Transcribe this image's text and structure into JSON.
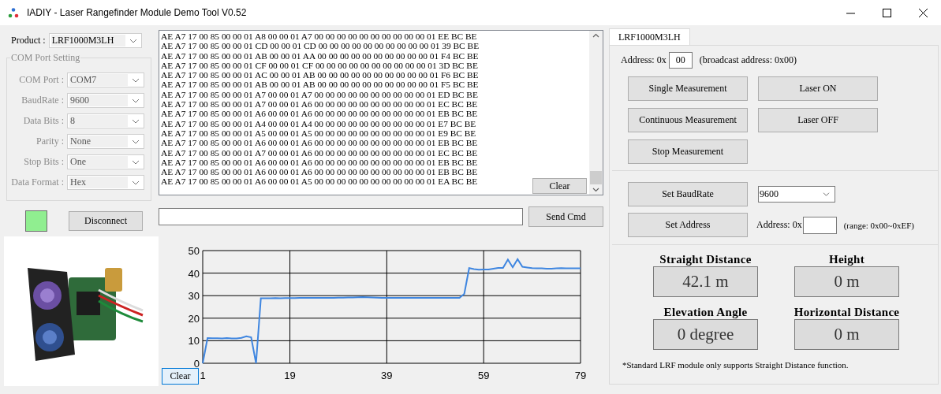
{
  "window": {
    "title": "IADIY - Laser Rangefinder Module Demo Tool V0.52"
  },
  "product": {
    "label": "Product :",
    "value": "LRF1000M3LH",
    "disabled": false
  },
  "com_port_setting": {
    "title": "COM Port Setting",
    "fields": [
      {
        "label": "COM Port :",
        "value": "COM7",
        "disabled": true
      },
      {
        "label": "BaudRate :",
        "value": "9600",
        "disabled": true
      },
      {
        "label": "Data Bits :",
        "value": "8",
        "disabled": true
      },
      {
        "label": "Parity :",
        "value": "None",
        "disabled": true
      },
      {
        "label": "Stop Bits :",
        "value": "One",
        "disabled": true
      },
      {
        "label": "Data Format :",
        "value": "Hex",
        "disabled": true
      }
    ]
  },
  "connection": {
    "connected": true,
    "button": "Disconnect"
  },
  "log": {
    "lines": [
      "AE A7 17 00 85 00 00 01 A8 00 00 01 A7 00 00 00 00 00 00 00 00 00 00 01 EE BC BE",
      "AE A7 17 00 85 00 00 01 CD 00 00 01 CD 00 00 00 00 00 00 00 00 00 00 01 39 BC BE",
      "AE A7 17 00 85 00 00 01 AB 00 00 01 AA 00 00 00 00 00 00 00 00 00 00 01 F4 BC BE",
      "AE A7 17 00 85 00 00 01 CF 00 00 01 CF 00 00 00 00 00 00 00 00 00 00 01 3D BC BE",
      "AE A7 17 00 85 00 00 01 AC 00 00 01 AB 00 00 00 00 00 00 00 00 00 00 01 F6 BC BE",
      "AE A7 17 00 85 00 00 01 AB 00 00 01 AB 00 00 00 00 00 00 00 00 00 00 01 F5 BC BE",
      "AE A7 17 00 85 00 00 01 A7 00 00 01 A7 00 00 00 00 00 00 00 00 00 00 01 ED BC BE",
      "AE A7 17 00 85 00 00 01 A7 00 00 01 A6 00 00 00 00 00 00 00 00 00 00 01 EC BC BE",
      "AE A7 17 00 85 00 00 01 A6 00 00 01 A6 00 00 00 00 00 00 00 00 00 00 01 EB BC BE",
      "AE A7 17 00 85 00 00 01 A4 00 00 01 A4 00 00 00 00 00 00 00 00 00 00 01 E7 BC BE",
      "AE A7 17 00 85 00 00 01 A5 00 00 01 A5 00 00 00 00 00 00 00 00 00 00 01 E9 BC BE",
      "AE A7 17 00 85 00 00 01 A6 00 00 01 A6 00 00 00 00 00 00 00 00 00 00 01 EB BC BE",
      "AE A7 17 00 85 00 00 01 A7 00 00 01 A6 00 00 00 00 00 00 00 00 00 00 01 EC BC BE",
      "AE A7 17 00 85 00 00 01 A6 00 00 01 A6 00 00 00 00 00 00 00 00 00 00 01 EB BC BE",
      "AE A7 17 00 85 00 00 01 A6 00 00 01 A6 00 00 00 00 00 00 00 00 00 00 01 EB BC BE",
      "AE A7 17 00 85 00 00 01 A6 00 00 01 A5 00 00 00 00 00 00 00 00 00 00 01 EA BC BE"
    ],
    "clear_button": "Clear"
  },
  "command": {
    "send_button": "Send Cmd"
  },
  "product_photo": {
    "kind": "picture"
  },
  "chart": {
    "clear_button": "Clear",
    "chart_data": {
      "type": "line",
      "grid": true,
      "xlim": [
        1,
        79
      ],
      "ylim": [
        0,
        50
      ],
      "xticks": [
        1,
        19,
        39,
        59,
        79
      ],
      "yticks": [
        0,
        10,
        20,
        30,
        40,
        50
      ],
      "x": [
        1,
        2,
        3,
        4,
        5,
        6,
        7,
        8,
        9,
        10,
        11,
        12,
        13,
        14,
        15,
        16,
        17,
        18,
        19,
        20,
        21,
        22,
        23,
        24,
        25,
        26,
        27,
        28,
        29,
        30,
        31,
        32,
        33,
        34,
        35,
        36,
        37,
        38,
        39,
        40,
        41,
        42,
        43,
        44,
        45,
        46,
        47,
        48,
        49,
        50,
        51,
        52,
        53,
        54,
        55,
        56,
        57,
        58,
        59,
        60,
        61,
        62,
        63,
        64,
        65,
        66,
        67,
        68,
        69,
        70,
        71,
        72,
        73,
        74,
        75,
        76,
        77,
        78,
        79
      ],
      "series": [
        {
          "color": "#3f86e0",
          "values": [
            0,
            11.2,
            11.1,
            11.1,
            11.0,
            11.2,
            11.0,
            11.0,
            11.3,
            12,
            11.5,
            0,
            28.8,
            28.8,
            28.8,
            28.9,
            28.8,
            28.9,
            28.9,
            28.9,
            29,
            29,
            29,
            29,
            29,
            29,
            29,
            29,
            29.1,
            29.1,
            29.2,
            29.2,
            29.3,
            29.4,
            29.3,
            29.2,
            29.1,
            29,
            29,
            29,
            29,
            29,
            29,
            29,
            29,
            29,
            29,
            29,
            29,
            29,
            29,
            29,
            29,
            29,
            30.8,
            42.2,
            41.8,
            41.5,
            41.6,
            41.6,
            42,
            42.3,
            42.3,
            46,
            42.6,
            46.2,
            42.8,
            42.5,
            42.2,
            42.1,
            42.1,
            42,
            42,
            42.1,
            42.2,
            42.1,
            42.1,
            42.1,
            42.1
          ]
        }
      ]
    }
  },
  "tabs": [
    {
      "label": "LRF1000M3LH",
      "selected": true
    }
  ],
  "address": {
    "label": "Address: 0x",
    "value": "00",
    "note": "(broadcast address: 0x00)"
  },
  "measure_buttons": [
    "Single Measurement",
    "Laser ON",
    "Continuous Measurement",
    "Laser OFF",
    "Stop Measurement"
  ],
  "settings": {
    "baud_button": "Set BaudRate",
    "baud_value": "9600",
    "address_button": "Set Address",
    "address_label": "Address: 0x",
    "range_note": "(range: 0x00~0xEF)"
  },
  "readouts": [
    {
      "label": "Straight Distance",
      "value": "42.1 m"
    },
    {
      "label": "Height",
      "value": "0 m"
    },
    {
      "label": "Elevation Angle",
      "value": "0 degree"
    },
    {
      "label": "Horizontal Distance",
      "value": "0 m"
    }
  ],
  "footnote": "*Standard LRF module only supports Straight Distance function."
}
